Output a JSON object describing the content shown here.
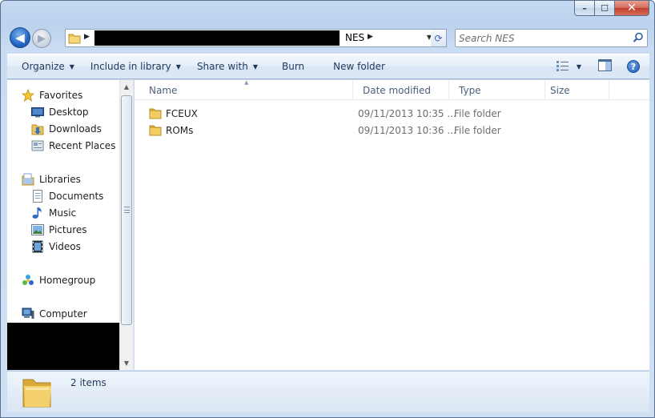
{
  "window": {
    "min_label": "–",
    "max_label": "☐",
    "close_label": "✕"
  },
  "nav": {
    "back_icon": "◀",
    "forward_icon": "▶",
    "address": {
      "crumb": "NES",
      "separator": "▶",
      "dropdown": "▼"
    },
    "refresh_icon": "⟳",
    "search": {
      "placeholder": "Search NES"
    }
  },
  "toolbar": {
    "organize": "Organize",
    "include_in_library": "Include in library",
    "share_with": "Share with",
    "burn": "Burn",
    "new_folder": "New folder",
    "dropdown_arrow": "▼",
    "help": "?"
  },
  "sidebar": {
    "favorites": "Favorites",
    "desktop": "Desktop",
    "downloads": "Downloads",
    "recent_places": "Recent Places",
    "libraries": "Libraries",
    "documents": "Documents",
    "music": "Music",
    "pictures": "Pictures",
    "videos": "Videos",
    "homegroup": "Homegroup",
    "computer": "Computer",
    "scroll_up": "▲",
    "scroll_down": "▼"
  },
  "columns": {
    "name": "Name",
    "date_modified": "Date modified",
    "type": "Type",
    "size": "Size",
    "sort_indicator": "▲"
  },
  "files": [
    {
      "name": "FCEUX",
      "date": "09/11/2013 10:35 ...",
      "type": "File folder"
    },
    {
      "name": "ROMs",
      "date": "09/11/2013 10:36 ...",
      "type": "File folder"
    }
  ],
  "status": {
    "item_count": "2 items"
  },
  "colors": {
    "folder": "#e8c45a",
    "accent": "#1e395b"
  }
}
